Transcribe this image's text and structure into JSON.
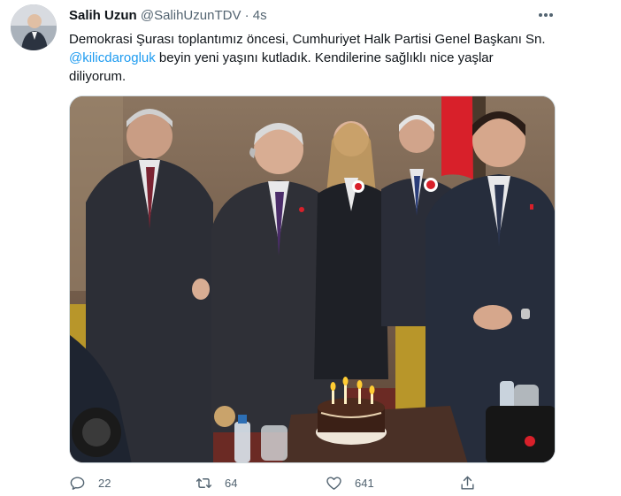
{
  "tweet": {
    "author_name": "Salih Uzun",
    "author_handle": "@SalihUzunTDV",
    "separator": "·",
    "time": "4s",
    "more_icon": "more-icon",
    "text_part1": "Demokrasi Şurası toplantımız öncesi, Cumhuriyet Halk Partisi Genel Başkanı Sn. ",
    "mention": "@kilicdarogluk",
    "text_part2": " beyin yeni yaşını kutladık. Kendilerine sağlıklı nice yaşlar diliyorum."
  },
  "actions": {
    "reply": {
      "icon": "reply-icon",
      "count": "22"
    },
    "retweet": {
      "icon": "retweet-icon",
      "count": "64"
    },
    "like": {
      "icon": "heart-icon",
      "count": "641"
    },
    "share": {
      "icon": "share-icon"
    }
  },
  "colors": {
    "accent": "#1d9bf0",
    "secondary_text": "#536471",
    "border": "#cfd9de"
  }
}
